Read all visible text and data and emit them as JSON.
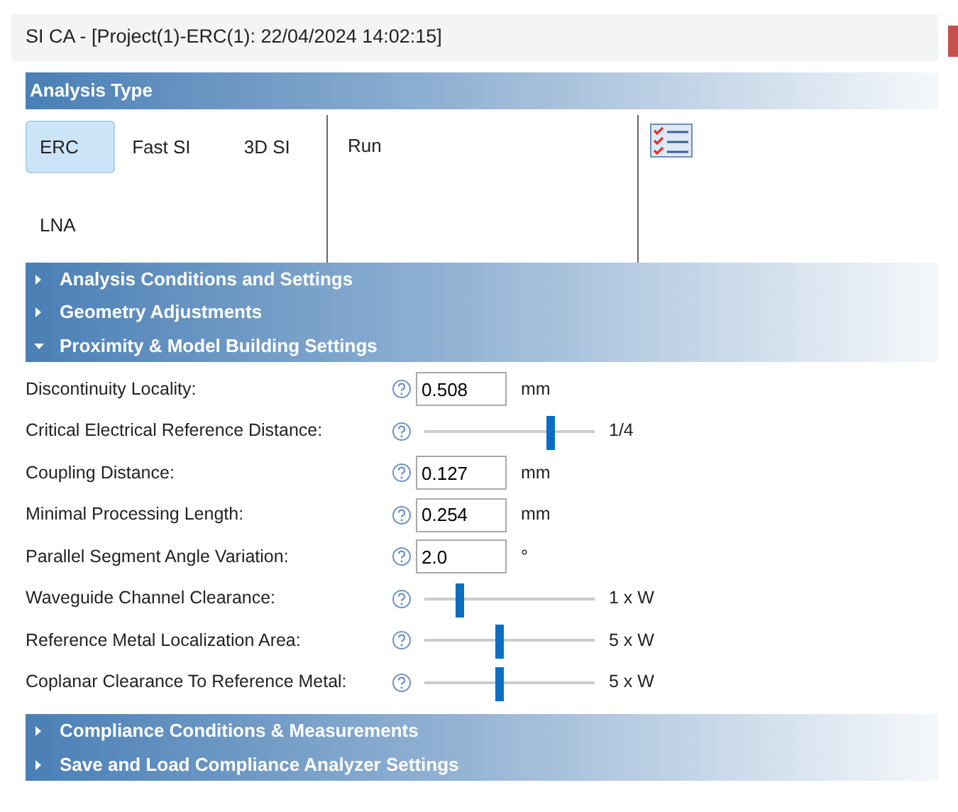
{
  "window": {
    "title": "SI CA - [Project(1)-ERC(1): 22/04/2024 14:02:15]"
  },
  "analysis_type": {
    "title": "Analysis Type",
    "types": [
      {
        "label": "ERC",
        "selected": true
      },
      {
        "label": "Fast SI",
        "selected": false
      },
      {
        "label": "3D SI",
        "selected": false
      },
      {
        "label": "LNA",
        "selected": false
      }
    ],
    "run_button": "Run"
  },
  "sections_top": [
    {
      "title": "Analysis Conditions and Settings",
      "expanded": false
    },
    {
      "title": "Geometry Adjustments",
      "expanded": false
    },
    {
      "title": "Proximity & Model Building Settings",
      "expanded": true
    }
  ],
  "settings": [
    {
      "kind": "input",
      "label": "Discontinuity Locality:",
      "value": "0.508",
      "unit": "mm"
    },
    {
      "kind": "slider",
      "label": "Critical Electrical Reference Distance:",
      "level": 0.74,
      "reading": "1/4"
    },
    {
      "kind": "input",
      "label": "Coupling Distance:",
      "value": "0.127",
      "unit": "mm"
    },
    {
      "kind": "input",
      "label": "Minimal Processing Length:",
      "value": "0.254",
      "unit": "mm"
    },
    {
      "kind": "input",
      "label": "Parallel Segment Angle Variation:",
      "value": "2.0",
      "unit": "°"
    },
    {
      "kind": "slider",
      "label": "Waveguide Channel Clearance:",
      "level": 0.21,
      "reading": "1 x W"
    },
    {
      "kind": "slider",
      "label": "Reference Metal Localization Area:",
      "level": 0.44,
      "reading": "5 x W"
    },
    {
      "kind": "slider",
      "label": "Coplanar Clearance To Reference Metal:",
      "level": 0.44,
      "reading": "5 x W"
    }
  ],
  "sections_bottom": [
    {
      "title": "Compliance Conditions & Measurements",
      "expanded": false
    },
    {
      "title": "Save and Load Compliance Analyzer Settings",
      "expanded": false
    }
  ]
}
